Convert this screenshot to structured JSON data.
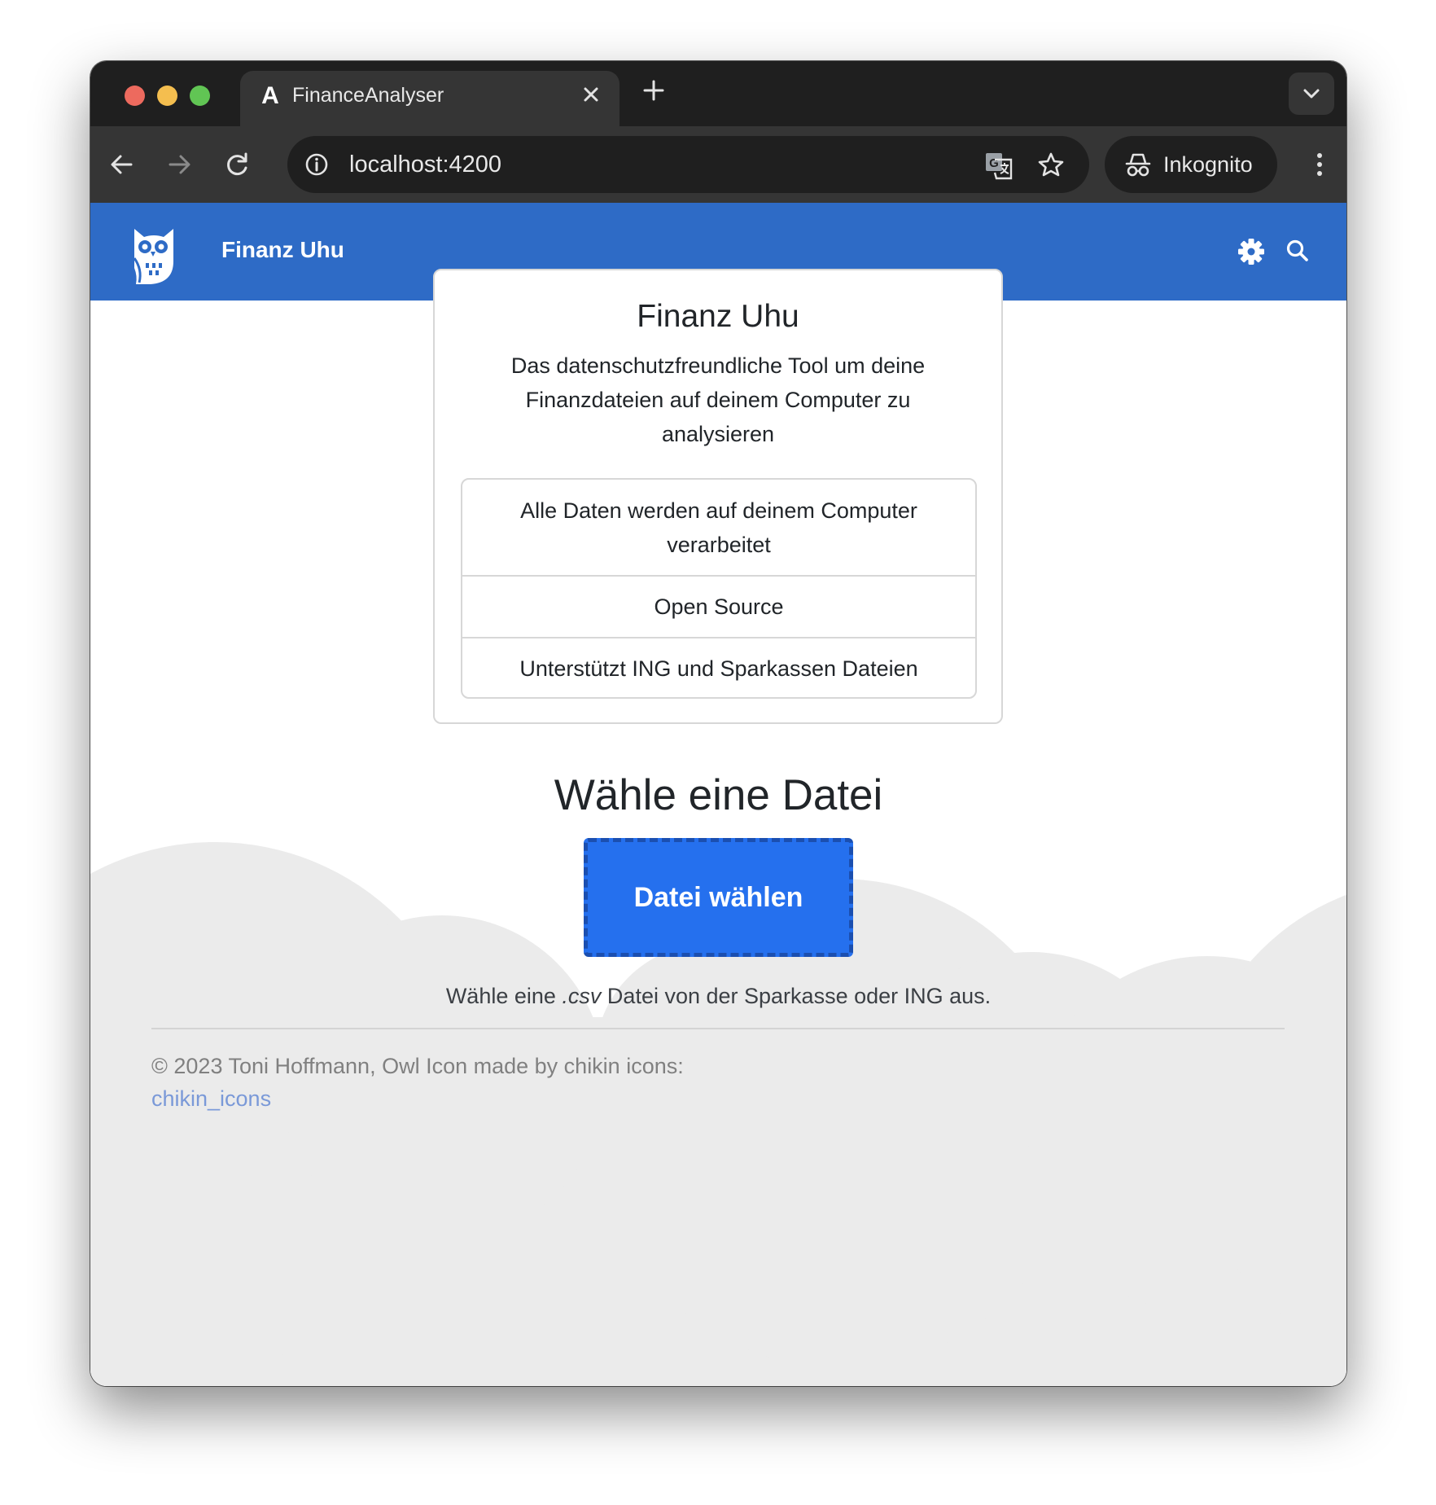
{
  "browser": {
    "tab_title": "FinanceAnalyser",
    "tab_favicon": "A",
    "url": "localhost:4200",
    "profile_label": "Inkognito",
    "icons": {
      "back": "arrow-left-icon",
      "forward": "arrow-right-icon",
      "reload": "reload-icon",
      "site_info": "info-icon",
      "translate": "translate-icon",
      "bookmark": "star-icon",
      "incognito": "incognito-icon",
      "menu": "kebab-menu-icon",
      "tab_search": "chevron-down-icon",
      "new_tab": "plus-icon",
      "close_tab": "close-icon"
    }
  },
  "navbar": {
    "brand": "Finanz Uhu",
    "logo": "owl-icon",
    "settings_icon": "gear-icon",
    "search_icon": "search-icon",
    "color": "#2e6bc6"
  },
  "intro_card": {
    "title": "Finanz Uhu",
    "description": "Das datenschutzfreundliche Tool um deine Finanzdateien auf deinem Computer zu analysieren",
    "features": [
      "Alle Daten werden auf deinem Computer verarbeitet",
      "Open Source",
      "Unterstützt ING und Sparkassen Dateien"
    ]
  },
  "upload": {
    "heading": "Wähle eine Datei",
    "button_label": "Datei wählen",
    "hint_prefix": "Wähle eine ",
    "hint_ext": ".csv",
    "hint_suffix": " Datei von der Sparkasse oder ING aus.",
    "button_color": "#2570ee"
  },
  "footer": {
    "text": "© 2023 Toni Hoffmann, Owl Icon made by chikin icons:",
    "link_label": "chikin_icons"
  }
}
